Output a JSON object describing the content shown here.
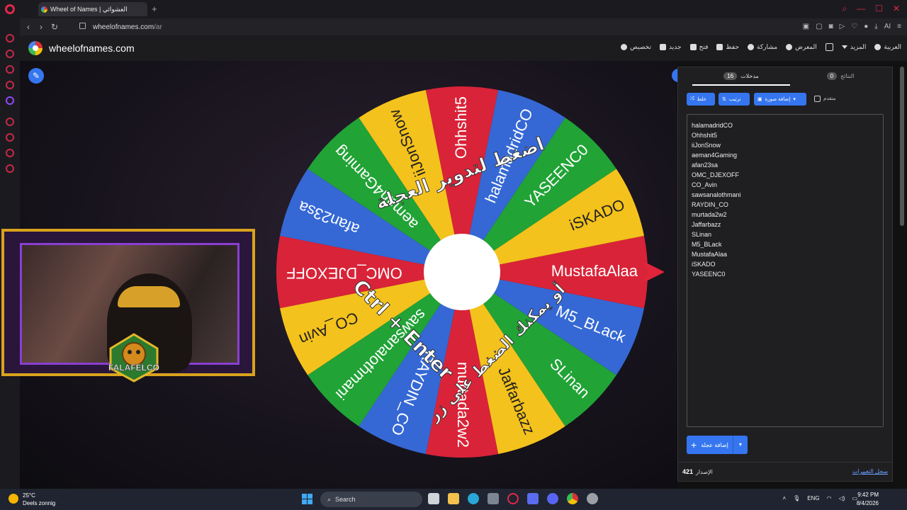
{
  "browser": {
    "tab_title": "Wheel of Names | العشوائي",
    "new_tab": "+",
    "url_host": "wheelofnames.com",
    "url_path": "/ar",
    "ext_label": "AI"
  },
  "site": {
    "name": "wheelofnames.com",
    "menu": [
      "تخصيص",
      "جديد",
      "فتح",
      "حفظ",
      "مشاركة",
      "المعرض",
      "المزيد",
      "العربية"
    ]
  },
  "wheel": {
    "center_color": "#ffffff",
    "segments": [
      {
        "label": "MustafaAlaa",
        "color": "#d92338"
      },
      {
        "label": "M5_BLack",
        "color": "#3568d4"
      },
      {
        "label": "SLinan",
        "color": "#21a336"
      },
      {
        "label": "Jaffarbazz",
        "color": "#f4c21c"
      },
      {
        "label": "murtada2w2",
        "color": "#d92338"
      },
      {
        "label": "RAYDIN_CO",
        "color": "#3568d4"
      },
      {
        "label": "sawsanalothmani",
        "color": "#21a336"
      },
      {
        "label": "CO_Avin",
        "color": "#f4c21c"
      },
      {
        "label": "OMC_DJEXOFF",
        "color": "#d92338"
      },
      {
        "label": "afan23sa",
        "color": "#3568d4"
      },
      {
        "label": "aeman4Gaming",
        "color": "#21a336"
      },
      {
        "label": "iiJonSnow",
        "color": "#f4c21c"
      },
      {
        "label": "Ohhshit5",
        "color": "#d92338"
      },
      {
        "label": "halamadridCO",
        "color": "#3568d4"
      },
      {
        "label": "YASEENC0",
        "color": "#21a336"
      },
      {
        "label": "iSKADO",
        "color": "#f4c21c"
      }
    ],
    "overlay_top": "اضغط لتدوير العجلة",
    "overlay_bottom_1": "أو يمكنك الضغط على زر",
    "overlay_bottom_2": "Ctrl + Enter"
  },
  "stream": {
    "badge_text": "FALAFELCO"
  },
  "panel": {
    "tab_entries_label": "مدخلات",
    "tab_entries_count": "16",
    "tab_results_label": "النتائج",
    "tab_results_count": "0",
    "shuffle_label": "خلط",
    "sort_label": "ترتيب",
    "add_image_label": "إضافة صورة",
    "advanced_label": "متقدم",
    "entries": [
      "halamadridCO",
      "Ohhshit5",
      "iiJonSnow",
      "aeman4Gaming",
      "afan23sa",
      "OMC_DJEXOFF",
      "CO_Avin",
      "sawsanalothmani",
      "RAYDIN_CO",
      "murtada2w2",
      "Jaffarbazz",
      "SLinan",
      "M5_BLack",
      "MustafaAlaa",
      "iSKADO",
      "YASEENC0"
    ],
    "add_wheel_label": "إضافة عجلة",
    "version_label": "الإصدار",
    "version_number": "421",
    "changelog_label": "سجل التغييرات"
  },
  "taskbar": {
    "weather_temp": "25°C",
    "weather_desc": "Deels zonnig",
    "search_placeholder": "Search",
    "lang": "ENG",
    "time": "9:42 PM",
    "date": "8/4/2026"
  }
}
